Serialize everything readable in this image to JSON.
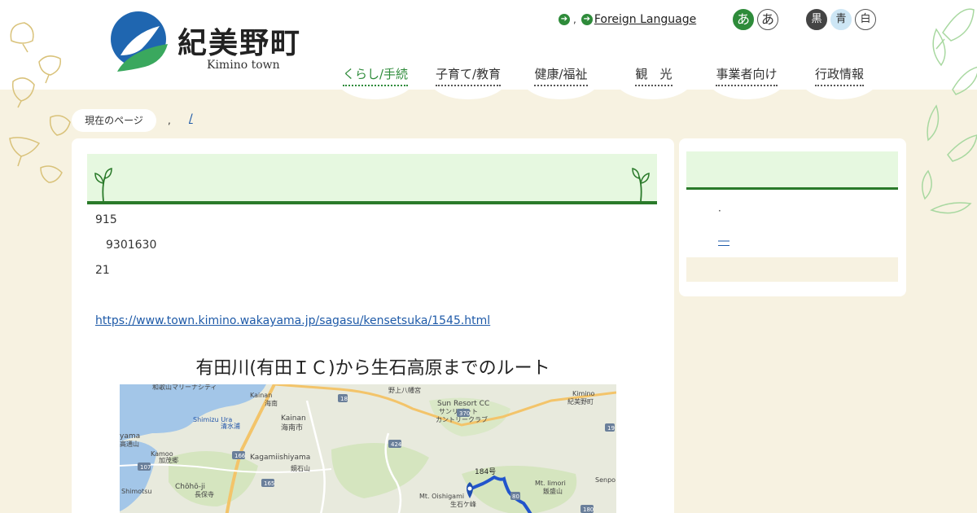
{
  "header": {
    "logo_title": "紀美野町",
    "logo_subtitle": "Kimino town",
    "util_sep": ",",
    "foreign_language": "Foreign Language",
    "font_size_buttons": [
      "あ",
      "あ"
    ],
    "color_buttons": [
      {
        "label": "黒",
        "bg": "#444444",
        "fg": "#ffffff"
      },
      {
        "label": "青",
        "bg": "#cde6f5",
        "fg": "#333333"
      },
      {
        "label": "白",
        "bg": "#ffffff",
        "fg": "#333333"
      }
    ]
  },
  "gnav": [
    {
      "label": "くらし/手続",
      "active": true
    },
    {
      "label": "子育て/教育",
      "active": false
    },
    {
      "label": "健康/福祉",
      "active": false
    },
    {
      "label": "観　光",
      "active": false
    },
    {
      "label": "事業者向け",
      "active": false
    },
    {
      "label": "行政情報",
      "active": false
    }
  ],
  "breadcrumb": {
    "current_label": "現在のページ",
    "separator": ",",
    "link": "/"
  },
  "main": {
    "lines": [
      "915",
      "9301630",
      "21"
    ],
    "url": "https://www.town.kimino.wakayama.jp/sagasu/kensetsuka/1545.html",
    "map_title": "有田川(有田ＩＣ)から生石高原までのルート",
    "map_labels": {
      "wakayama_marina": "和歌山マリーナシティ",
      "kainan": "Kainan",
      "kainan_station": "海南",
      "kainan_city_en": "Kainan",
      "kainan_city_jp": "海南市",
      "shimizu": "Shimizu Ura",
      "shimizu_jp": "清水浦",
      "ayama": "yama",
      "ayama_jp": "高通山",
      "kamooo": "Kamoo",
      "kamooo_jp": "加茂郷",
      "kagamiishiyama": "Kagamiishiyama",
      "kagamiishiyama_jp": "鏡石山",
      "chohoji": "Chōhō-ji",
      "chohoji_jp": "長保寺",
      "shimotsu": "Shimotsu",
      "nokami": "野上八幡宮",
      "sun_resort_en": "Sun Resort CC",
      "sun_resort_jp1": "サンリゾート",
      "sun_resort_jp2": "カントリークラブ",
      "kimino_en": "Kimino",
      "kimino_jp": "紀美野町",
      "route_184": "184号",
      "oishigamine": "Mt. Oishigami",
      "oishigamine_jp": "生石ケ峰",
      "iimori": "Mt. Iimori",
      "iimori_jp": "飯盛山",
      "senpo": "Senpo",
      "road_370": "370",
      "road_18": "18",
      "road_424": "424",
      "road_166": "166",
      "road_165": "165",
      "road_107": "107",
      "road_180": "180",
      "road_19": "19",
      "road_80": "80"
    },
    "colors": {
      "accent": "#2a7a2a",
      "title_bg": "#e6f8e0",
      "route": "#2255cc"
    }
  },
  "side": {
    "dot": "·",
    "link": "―"
  }
}
